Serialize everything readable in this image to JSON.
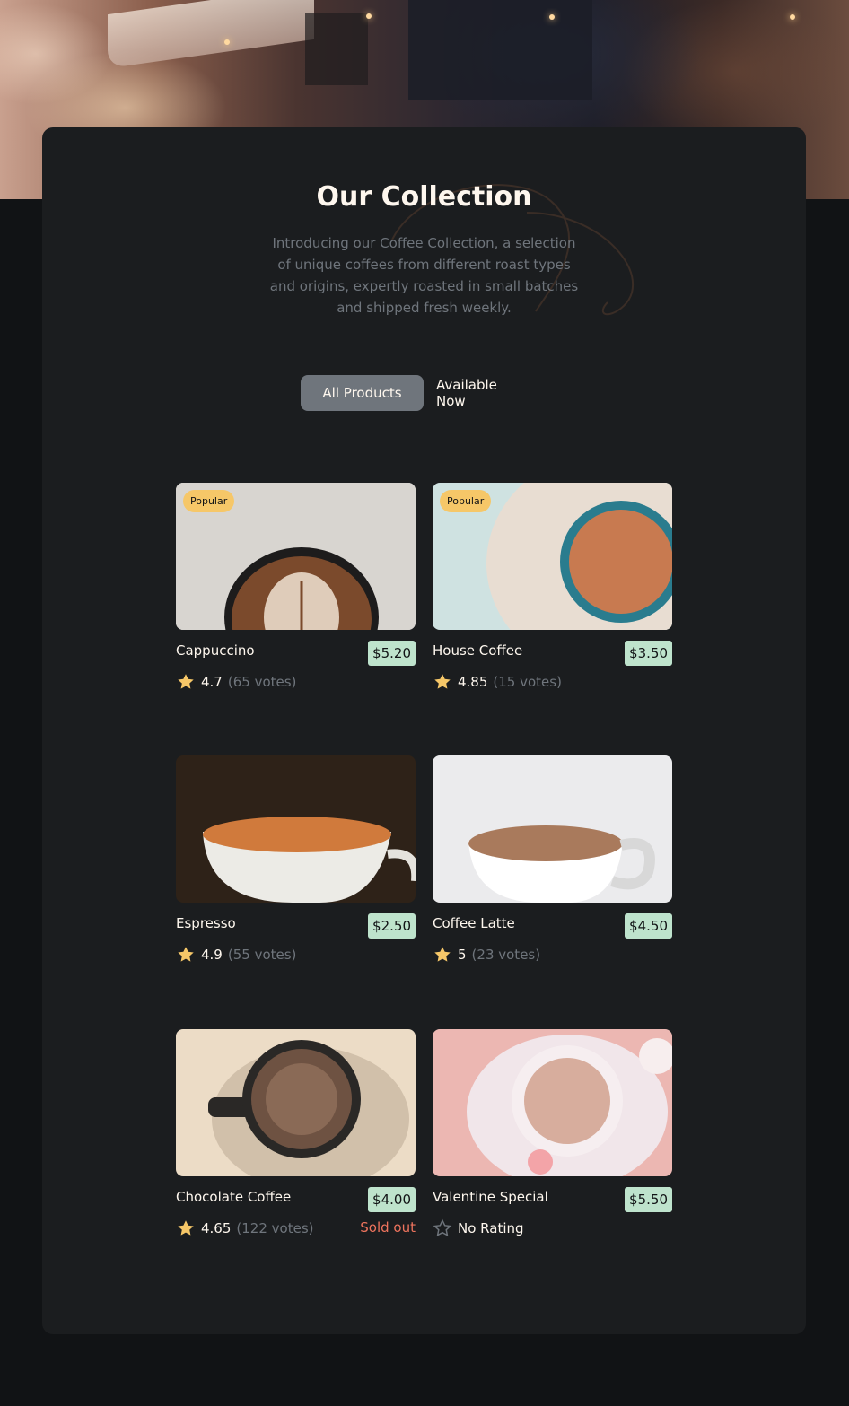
{
  "colors": {
    "page_bg": "#111315",
    "panel_bg": "#1B1D1F",
    "text_light": "#FEF7EE",
    "text_muted": "#6F757C",
    "badge_bg": "#F6C768",
    "price_bg": "#BEE3CC",
    "sold_out": "#ED735D"
  },
  "hero": {
    "icon": "cafe-photo"
  },
  "collection": {
    "title": "Our Collection",
    "intro": "Introducing our Coffee Collection, a selection of unique coffees from different roast types and origins, expertly roasted in small batches and shipped fresh weekly."
  },
  "tabs": [
    {
      "label": "All Products",
      "active": true
    },
    {
      "label": "Available Now",
      "active": false
    }
  ],
  "products": [
    {
      "name": "Cappuccino",
      "price": "$5.20",
      "badge": "Popular",
      "rating": "4.7",
      "votes": "(65 votes)",
      "status": "",
      "icon": "star-filled-icon"
    },
    {
      "name": "House Coffee",
      "price": "$3.50",
      "badge": "Popular",
      "rating": "4.85",
      "votes": "(15 votes)",
      "status": "",
      "icon": "star-filled-icon"
    },
    {
      "name": "Espresso",
      "price": "$2.50",
      "badge": "",
      "rating": "4.9",
      "votes": "(55 votes)",
      "status": "",
      "icon": "star-filled-icon"
    },
    {
      "name": "Coffee Latte",
      "price": "$4.50",
      "badge": "",
      "rating": "5",
      "votes": "(23 votes)",
      "status": "",
      "icon": "star-filled-icon"
    },
    {
      "name": "Chocolate Coffee",
      "price": "$4.00",
      "badge": "",
      "rating": "4.65",
      "votes": "(122 votes)",
      "status": "Sold out",
      "icon": "star-filled-icon"
    },
    {
      "name": "Valentine Special",
      "price": "$5.50",
      "badge": "",
      "rating": "No Rating",
      "votes": "",
      "status": "",
      "icon": "star-outline-icon"
    }
  ]
}
